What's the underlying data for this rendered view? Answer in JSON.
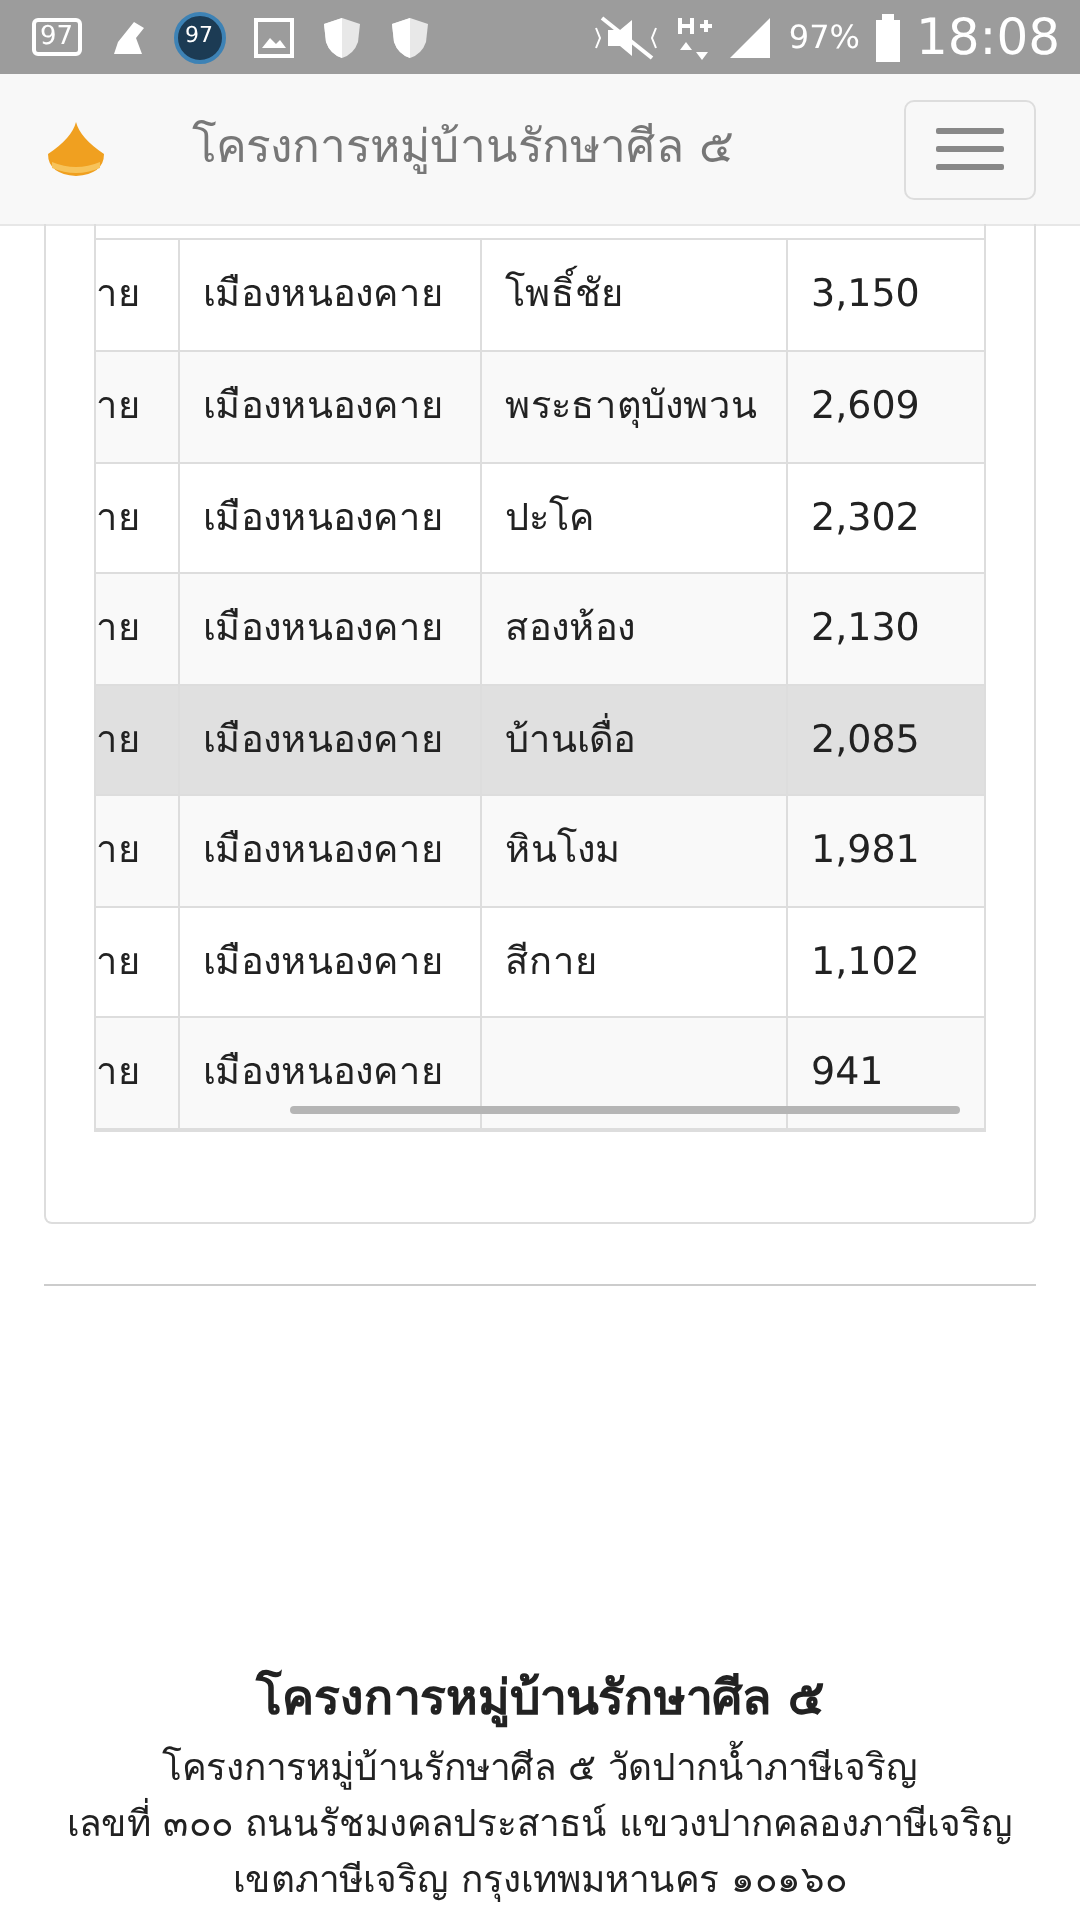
{
  "status_bar": {
    "notification_badge": "97",
    "circle_badge": "97",
    "battery_percent": "97%",
    "time": "18:08"
  },
  "navbar": {
    "title": "โครงการหมู่บ้านรักษาศีล ๕",
    "menu_expanded": false
  },
  "table": {
    "rows": [
      {
        "cells": [
          "าย",
          "เมืองหนองคาย",
          "โพธิ์ชัย",
          "3,150"
        ],
        "highlighted": false
      },
      {
        "cells": [
          "าย",
          "เมืองหนองคาย",
          "พระธาตุบังพวน",
          "2,609"
        ],
        "highlighted": false
      },
      {
        "cells": [
          "าย",
          "เมืองหนองคาย",
          "ปะโค",
          "2,302"
        ],
        "highlighted": false
      },
      {
        "cells": [
          "าย",
          "เมืองหนองคาย",
          "สองห้อง",
          "2,130"
        ],
        "highlighted": false
      },
      {
        "cells": [
          "าย",
          "เมืองหนองคาย",
          "บ้านเดื่อ",
          "2,085"
        ],
        "highlighted": true
      },
      {
        "cells": [
          "าย",
          "เมืองหนองคาย",
          "หินโงม",
          "1,981"
        ],
        "highlighted": false
      },
      {
        "cells": [
          "าย",
          "เมืองหนองคาย",
          "สีกาย",
          "1,102"
        ],
        "highlighted": false
      },
      {
        "cells": [
          "าย",
          "เมืองหนองคาย",
          "",
          "941"
        ],
        "highlighted": false
      }
    ]
  },
  "footer": {
    "heading": "โครงการหมู่บ้านรักษาศีล ๕",
    "lines": [
      "โครงการหมู่บ้านรักษาศีล ๕ วัดปากน้ำภาษีเจริญ",
      "เลขที่ ๓๐๐ ถนนรัชมงคลประสาธน์ แขวงปากคลองภาษีเจริญ",
      "เขตภาษีเจริญ กรุงเทพมหานคร ๑๐๑๖๐"
    ]
  }
}
